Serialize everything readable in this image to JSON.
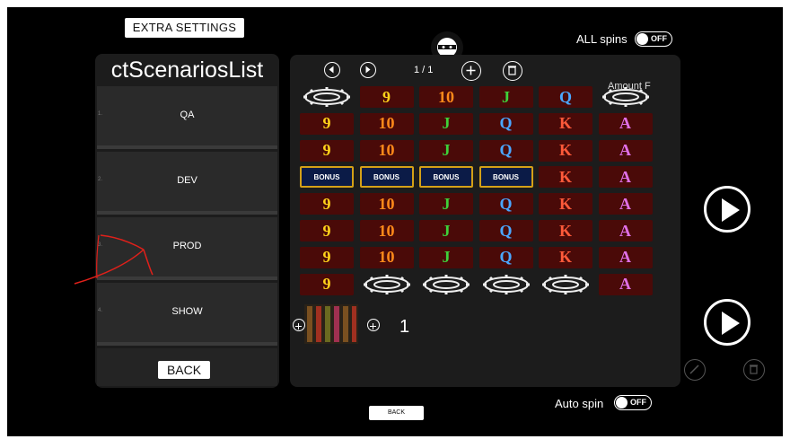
{
  "header": {
    "extra_settings": "EXTRA SETTINGS",
    "all_spins_label": "ALL spins",
    "all_spins_state": "OFF",
    "center_icon": "ninja-mask-icon"
  },
  "scenarios": {
    "title": "ctScenariosList",
    "items": [
      {
        "num": "1.",
        "label": "QA"
      },
      {
        "num": "2.",
        "label": "DEV"
      },
      {
        "num": "3.",
        "label": "PROD"
      },
      {
        "num": "4.",
        "label": "SHOW"
      }
    ],
    "back_label": "BACK"
  },
  "grid_panel": {
    "toolbar": {
      "prev_icon": "circle-left-icon",
      "next_icon": "circle-right-icon",
      "page_indicator": "1 / 1",
      "add_icon": "plus-circle-icon",
      "delete_icon": "trash-icon"
    },
    "amount_label": "Amount F",
    "rows": [
      [
        "GEAR",
        "9",
        "10",
        "J",
        "Q",
        "GEAR"
      ],
      [
        "9",
        "10",
        "J",
        "Q",
        "K",
        "A"
      ],
      [
        "9",
        "10",
        "J",
        "Q",
        "K",
        "A"
      ],
      [
        "BONUS",
        "BONUS",
        "BONUS",
        "BONUS",
        "K",
        "A"
      ],
      [
        "9",
        "10",
        "J",
        "Q",
        "K",
        "A"
      ],
      [
        "9",
        "10",
        "J",
        "Q",
        "K",
        "A"
      ],
      [
        "9",
        "10",
        "J",
        "Q",
        "K",
        "A"
      ],
      [
        "9",
        "GEAR",
        "GEAR",
        "GEAR",
        "GEAR",
        "A"
      ]
    ],
    "counter_value": "1"
  },
  "controls": {
    "play_icon": "play-icon",
    "edit_icon": "pencil-icon",
    "delete_icon": "trash-icon"
  },
  "footer": {
    "auto_spin_label": "Auto spin",
    "auto_spin_state": "OFF",
    "back_label": "BACK"
  },
  "colors": {
    "background": "#000000",
    "panel": "#1c1c1c",
    "annotation_red": "#e0201a"
  }
}
